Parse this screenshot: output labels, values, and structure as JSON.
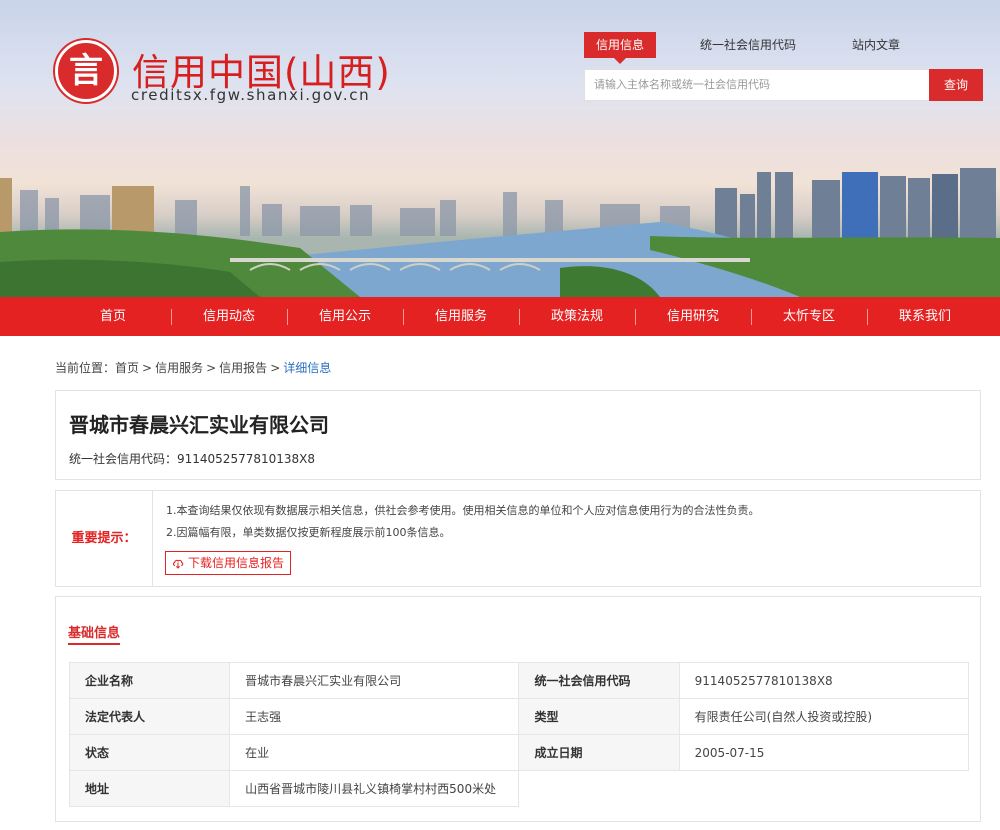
{
  "header": {
    "logo_glyph": "言",
    "site_title": "信用中国(山西)",
    "site_domain": "creditsx.fgw.shanxi.gov.cn",
    "search_tabs": [
      "信用信息",
      "统一社会信用代码",
      "站内文章"
    ],
    "search_placeholder": "请输入主体名称或统一社会信用代码",
    "search_button": "查询"
  },
  "nav": {
    "items": [
      "首页",
      "信用动态",
      "信用公示",
      "信用服务",
      "政策法规",
      "信用研究",
      "太忻专区",
      "联系我们"
    ]
  },
  "breadcrumb": {
    "prefix": "当前位置：",
    "items": [
      "首页",
      "信用服务",
      "信用报告",
      "详细信息"
    ]
  },
  "company": {
    "name": "晋城市春晨兴汇实业有限公司",
    "code_line": "统一社会信用代码：9114052577810138X8"
  },
  "notice": {
    "label": "重要提示：",
    "lines": [
      "1.本查询结果仅依现有数据展示相关信息，供社会参考使用。使用相关信息的单位和个人应对信息使用行为的合法性负责。",
      "2.因篇幅有限，单类数据仅按更新程度展示前100条信息。"
    ],
    "download_label": "下载信用信息报告"
  },
  "basic": {
    "title": "基础信息",
    "rows": [
      {
        "k1": "企业名称",
        "v1": "晋城市春晨兴汇实业有限公司",
        "k2": "统一社会信用代码",
        "v2": "9114052577810138X8"
      },
      {
        "k1": "法定代表人",
        "v1": "王志强",
        "k2": "类型",
        "v2": "有限责任公司(自然人投资或控股)"
      },
      {
        "k1": "状态",
        "v1": "在业",
        "k2": "成立日期",
        "v2": "2005-07-15"
      },
      {
        "k1": "地址",
        "v1": "山西省晋城市陵川县礼义镇椅掌村村西500米处",
        "k2": "",
        "v2": ""
      }
    ]
  },
  "colors": {
    "brand_red": "#e52222",
    "link_blue": "#2a6fbe"
  }
}
